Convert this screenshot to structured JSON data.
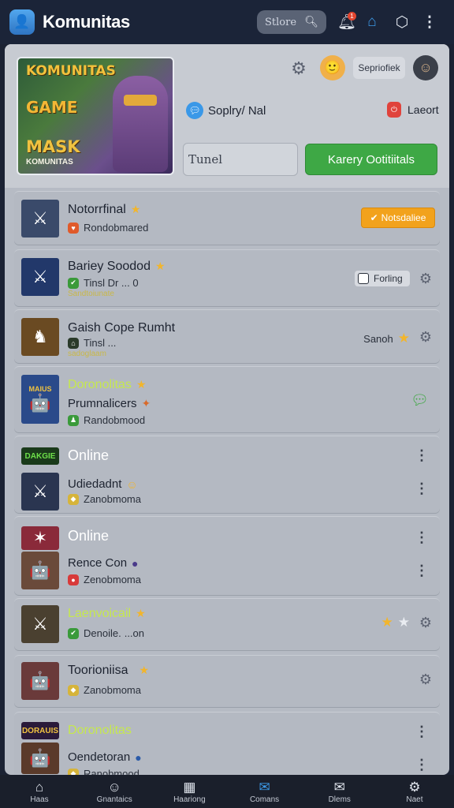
{
  "header": {
    "title": "Komunitas",
    "search_label": "Stlore",
    "search_icon": "search-icon",
    "notif_count": "1"
  },
  "hero": {
    "banner_line1": "KOMUNITAS",
    "banner_line2": "GAME",
    "banner_line3": "MASK",
    "banner_line4": "KOMUNITAS",
    "username": "Sepriofiek",
    "social_label": "Soplry/ Nal",
    "logout_label": "Laeort",
    "input_value": "Tunel",
    "cta_label": "Karery Ootitiitals"
  },
  "rows": [
    {
      "title": "Notorrfinal",
      "sub": "Rondobmared",
      "action": "Notsdaliee"
    },
    {
      "title": "Bariey Soodod",
      "sub": "Tinsl Dr ... 0",
      "sub2": "Sandtoiunate",
      "toggle": "Forling"
    },
    {
      "title": "Gaish Cope Rumht",
      "sub": "Tinsl ...",
      "sub2": "sadoglaam",
      "rate_label": "Sanoh"
    },
    {
      "title": "Doronolitas",
      "sub": "Prumnalicers",
      "sub2": "Randobmood",
      "thumb_text": "MAIUS"
    },
    {
      "title": "Online",
      "sub": "Udiedadnt",
      "sub2": "Zanobmoma",
      "thumb_text": "DAKGIE"
    },
    {
      "title": "Online",
      "sub": "Rence Con",
      "sub2": "Zenobmoma"
    },
    {
      "title": "Laenvoicail",
      "sub": "Denoile.",
      "sub2": "...on"
    },
    {
      "title": "Toorioniisa",
      "sub": "Zanobmoma"
    },
    {
      "title": "Doronolitas",
      "sub": "Oendetoran",
      "sub2": "Ranobmood",
      "thumb_text": "DORAUIS"
    }
  ],
  "nav": [
    {
      "label": "Haas",
      "icon": "home-icon"
    },
    {
      "label": "Gnantaics",
      "icon": "profile-icon"
    },
    {
      "label": "Haariong",
      "icon": "calendar-icon"
    },
    {
      "label": "Comans",
      "icon": "chat-icon"
    },
    {
      "label": "Dlems",
      "icon": "mail-icon"
    },
    {
      "label": "Naet",
      "icon": "gear-icon"
    }
  ],
  "colors": {
    "accent_green": "#3ea845",
    "accent_orange": "#f2a21c",
    "lime_text": "#c6e84e"
  }
}
